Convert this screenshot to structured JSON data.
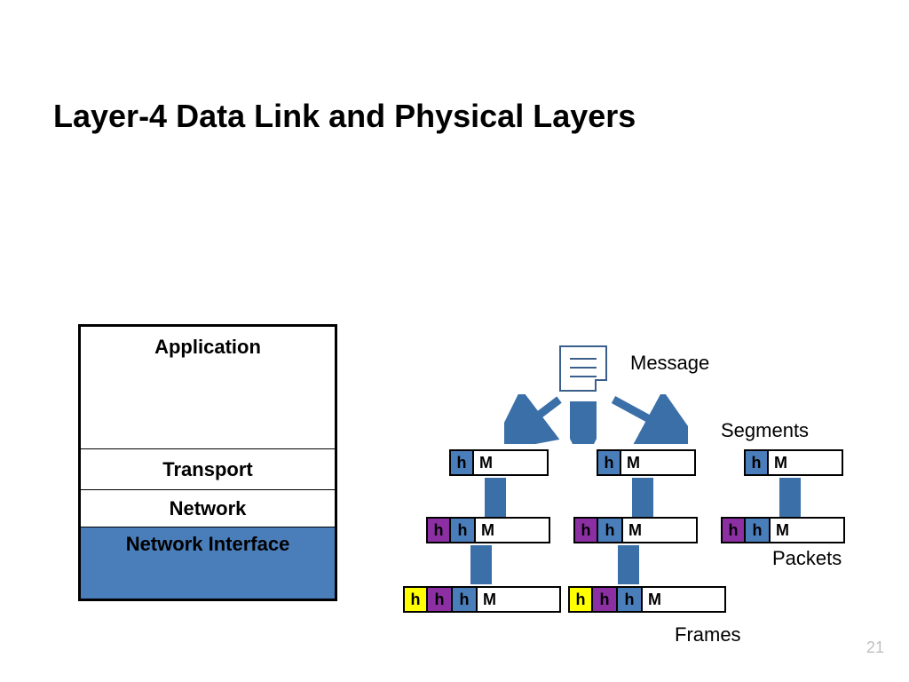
{
  "title": "Layer-4 Data Link and Physical Layers",
  "page_number": "21",
  "layers": {
    "application": "Application",
    "transport": "Transport",
    "network": "Network",
    "network_interface": "Network Interface"
  },
  "labels": {
    "message": "Message",
    "segments": "Segments",
    "packets": "Packets",
    "frames": "Frames"
  },
  "cells": {
    "h": "h",
    "m": "M"
  },
  "colors": {
    "blue": "#4a7ebb",
    "purple": "#8c2fa3",
    "yellow": "#ffff00",
    "arrow": "#3a6fa8"
  }
}
